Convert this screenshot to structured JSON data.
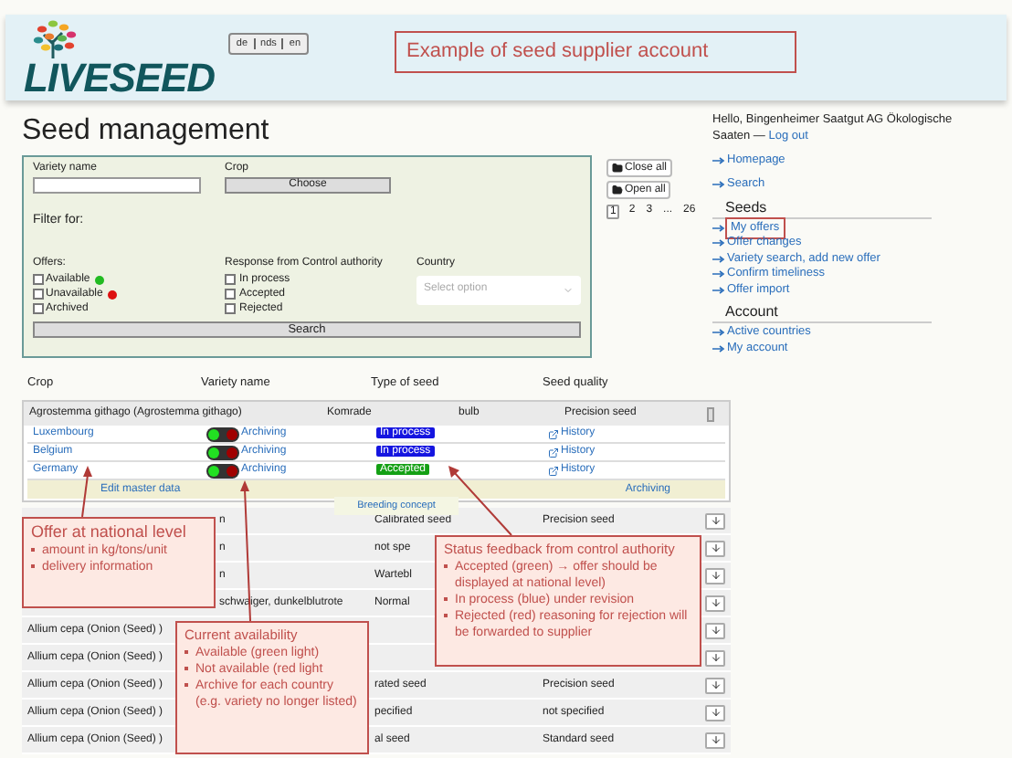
{
  "header": {
    "logo": "LIVESEED",
    "languages": [
      "de",
      "nds",
      "en"
    ],
    "note": "Example of seed supplier account"
  },
  "title": "Seed management",
  "filter": {
    "variety_label": "Variety name",
    "crop_label": "Crop",
    "crop_button": "Choose",
    "filter_for": "Filter for:",
    "offers": {
      "label": "Offers:",
      "options": [
        {
          "label": "Available",
          "checked": false,
          "color": "#22bb22"
        },
        {
          "label": "Unavailable",
          "checked": false,
          "color": "#dd1111"
        },
        {
          "label": "Archived",
          "checked": false
        }
      ]
    },
    "response": {
      "label": "Response from Control authority",
      "options": [
        {
          "label": "In process",
          "checked": false
        },
        {
          "label": "Accepted",
          "checked": false
        },
        {
          "label": "Rejected",
          "checked": false
        }
      ]
    },
    "country": {
      "label": "Country",
      "placeholder": "Select option"
    },
    "search_button": "Search"
  },
  "actions": [
    "Close all",
    "Open all"
  ],
  "pagination": [
    {
      "label": "1",
      "selected": true
    },
    {
      "label": "2",
      "selected": false
    },
    {
      "label": "3",
      "selected": false
    },
    {
      "label": "...",
      "selected": false
    },
    {
      "label": "26",
      "selected": false
    }
  ],
  "sidebar": {
    "greeting": "Hello, Bingenheimer Saatgut AG Ökologische Saaten —",
    "logout": "Log out",
    "links": [
      "Homepage",
      "Search"
    ],
    "sections": [
      {
        "title": "Seeds",
        "items": [
          {
            "label": "My offers",
            "highlighted": true
          },
          {
            "label": "Offer changes",
            "highlighted": false
          },
          {
            "label": "Variety search, add new offer",
            "highlighted": false
          },
          {
            "label": "Confirm timeliness",
            "highlighted": false
          },
          {
            "label": "Offer import",
            "highlighted": false
          }
        ]
      },
      {
        "title": "Account",
        "items": [
          {
            "label": "Active countries",
            "highlighted": false
          },
          {
            "label": "My account",
            "highlighted": false
          }
        ]
      }
    ]
  },
  "table": {
    "columns": [
      "Crop",
      "Variety name",
      "Type of seed",
      "Seed quality"
    ],
    "group": {
      "crop": "Agrostemma githago (Agrostemma githago)",
      "variety": "Komrade",
      "type": "bulb",
      "quality": "Precision seed",
      "offers": [
        {
          "country": "Luxembourg",
          "available": true,
          "archive_link": "Archiving",
          "status": "In process",
          "kind": "in_process",
          "history": "History"
        },
        {
          "country": "Belgium",
          "available": true,
          "archive_link": "Archiving",
          "status": "In process",
          "kind": "in_process",
          "history": "History"
        },
        {
          "country": "Germany",
          "available": true,
          "archive_link": "Archiving",
          "status": "Accepted",
          "kind": "accepted",
          "history": "History"
        }
      ],
      "edit_link": "Edit master data",
      "archive_link": "Archiving",
      "tab": "Breeding concept"
    },
    "rows": [
      {
        "variety": "n",
        "type": "Calibrated seed",
        "quality": "Precision seed"
      },
      {
        "variety": "n",
        "type": "not spe"
      },
      {
        "variety": "n",
        "type": "Wartebl"
      },
      {
        "variety": "schwaiger, dunkelblutrote",
        "type": "Normal"
      },
      {
        "crop": "Allium cepa (Onion (Seed) )"
      },
      {
        "crop": "Allium cepa (Onion (Seed) )"
      },
      {
        "crop": "Allium cepa (Onion (Seed) )",
        "type": "rated seed",
        "quality": "Precision seed"
      },
      {
        "crop": "Allium cepa (Onion (Seed) )",
        "type": "pecified",
        "quality": "not specified"
      },
      {
        "crop": "Allium cepa (Onion (Seed) )",
        "type": "al seed",
        "quality": "Standard seed"
      }
    ]
  },
  "callouts": [
    {
      "title": "Offer at national level",
      "bullets": [
        "amount in kg/tons/unit",
        "delivery information"
      ]
    },
    {
      "title": "Current availability",
      "bullets": [
        "Available (green light)",
        "Not available (red light",
        "Archive for each country (e.g. variety  no longer listed)"
      ]
    },
    {
      "title": "Status feedback from control authority",
      "bullets": [
        "Accepted (green) → offer should be displayed at national level)",
        "In process (blue) under revision",
        "Rejected (red) reasoning for rejection will be forwarded to supplier"
      ]
    }
  ]
}
